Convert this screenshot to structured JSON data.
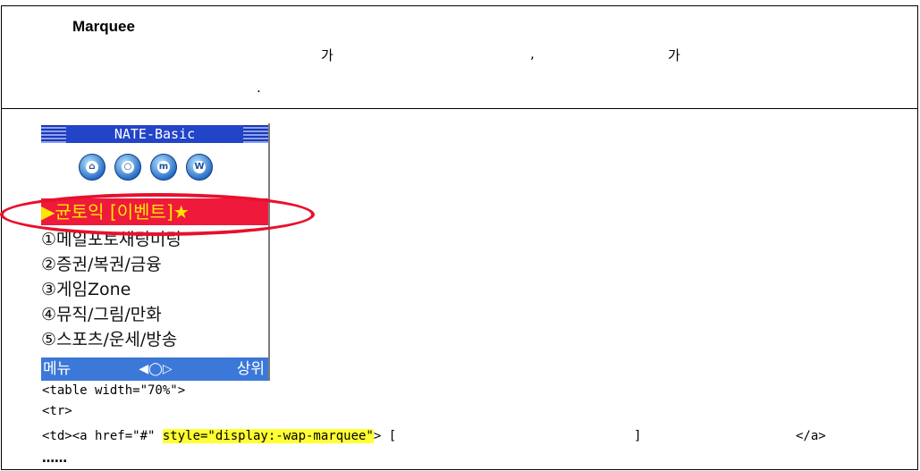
{
  "header": {
    "title": "Marquee",
    "line1_a": "가",
    "line1_comma": ",",
    "line1_b": "가",
    "line2_dot": "."
  },
  "phone": {
    "title": "NATE-Basic",
    "icons": [
      "home-icon",
      "search-icon",
      "m-icon",
      "w-icon"
    ],
    "selected_item": "▶균토익 [이벤트]★",
    "menu_items": [
      "①메일포토채팅미팅",
      "②증권/복권/금융",
      "③게임Zone",
      "④뮤직/그림/만화",
      "⑤스포츠/운세/방송"
    ],
    "softkeys": {
      "left": "메뉴",
      "center": "◀◯▷",
      "right": "상위"
    }
  },
  "code": {
    "line1": "<table width=\"70%\">",
    "line2": "<tr>",
    "line3_a": "<td><a href=\"#\" ",
    "line3_hl": "style=\"display:-wap-marquee\"",
    "line3_b": "> [",
    "line3_c": "]",
    "line3_d": "</a>",
    "line4": "……"
  },
  "colors": {
    "highlight": "#ffff33",
    "ellipse": "#e8102c",
    "selected_bg": "#ef1a3b"
  }
}
